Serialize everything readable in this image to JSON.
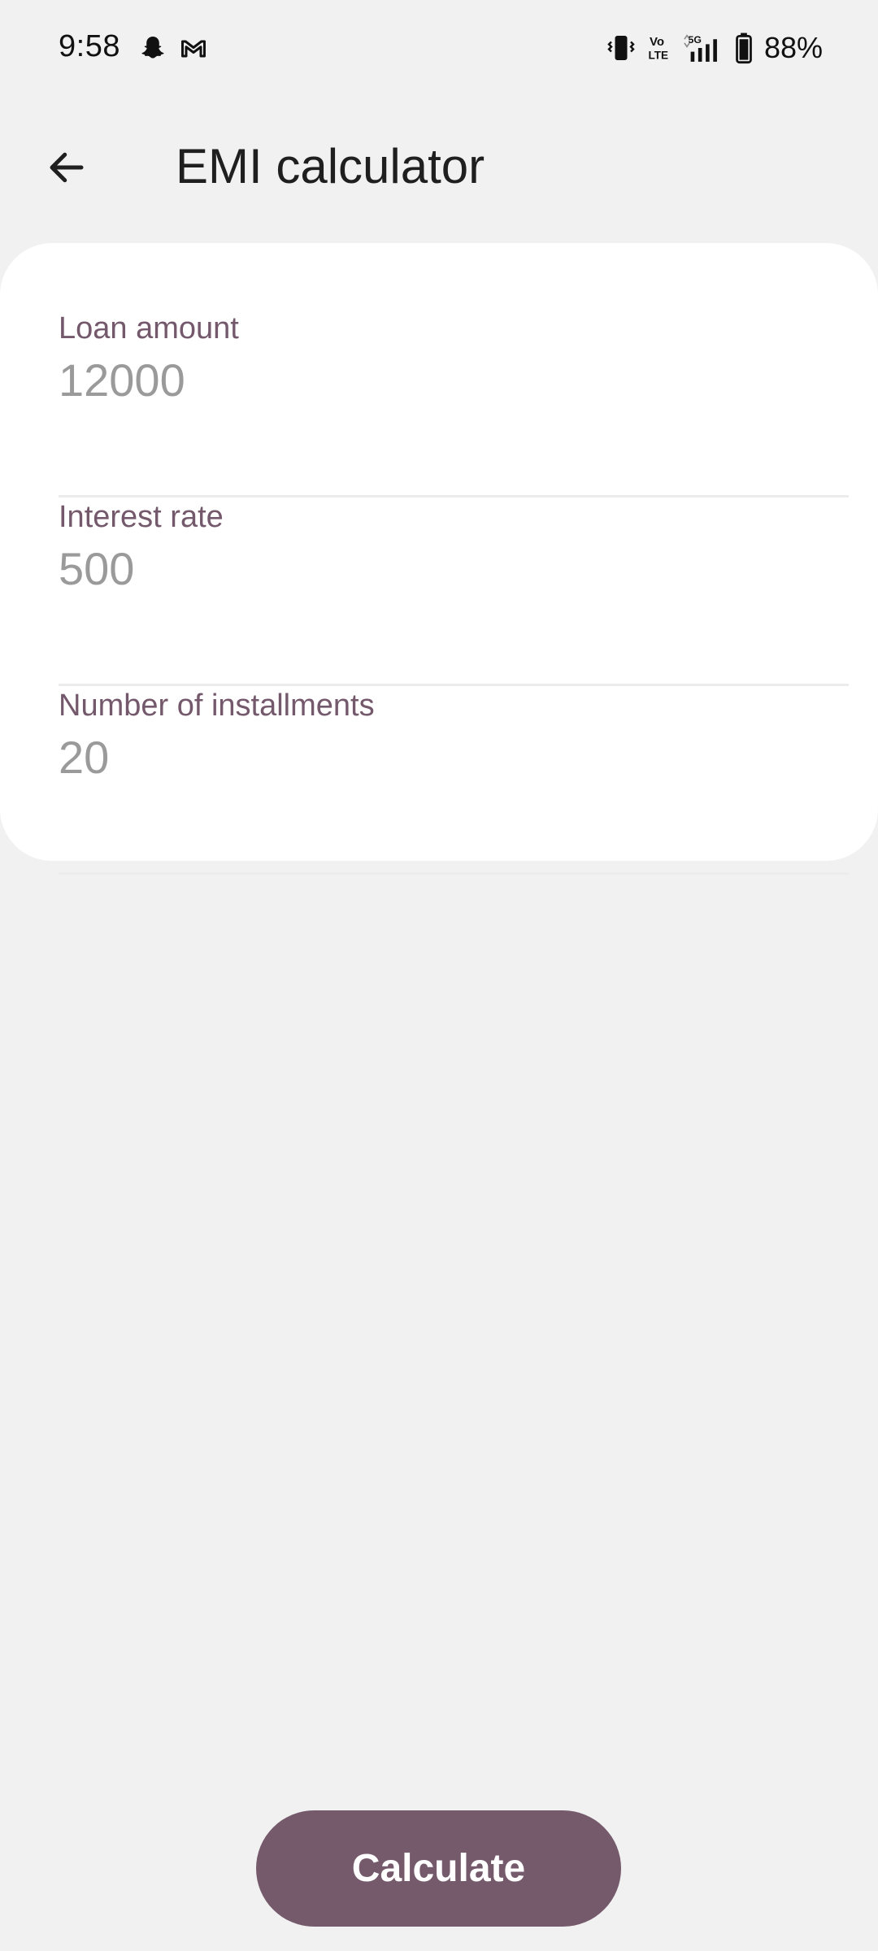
{
  "status_bar": {
    "time": "9:58",
    "battery_percent": "88%",
    "icons": [
      "snapchat-icon",
      "gmail-icon",
      "vibrate-icon",
      "volte-icon",
      "5g-signal-icon",
      "battery-icon"
    ]
  },
  "app_bar": {
    "title": "EMI calculator",
    "back_icon": "arrow-back-icon"
  },
  "form": {
    "loan_amount": {
      "label": "Loan amount",
      "placeholder": "12000"
    },
    "interest_rate": {
      "label": "Interest rate",
      "placeholder": "500"
    },
    "installments": {
      "label": "Number of installments",
      "placeholder": "20"
    }
  },
  "actions": {
    "calculate_label": "Calculate"
  },
  "colors": {
    "background": "#f1f1f1",
    "card": "#ffffff",
    "accent": "#755a6c",
    "label": "#74586b",
    "placeholder": "#9a9a9a"
  }
}
